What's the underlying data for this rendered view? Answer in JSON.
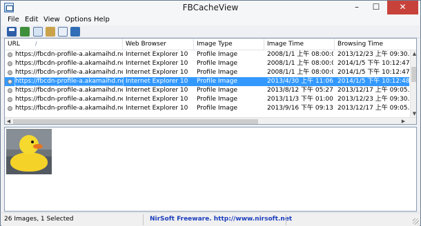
{
  "window": {
    "title": "FBCacheView",
    "controls": {
      "minimize": "–",
      "maximize": "☐",
      "close": "✕"
    }
  },
  "menu": [
    "File",
    "Edit",
    "View",
    "Options",
    "Help"
  ],
  "toolbar": {
    "icons": [
      "save-icon",
      "html-report-icon",
      "copy-icon",
      "properties-icon",
      "find-icon",
      "exit-icon"
    ]
  },
  "table": {
    "columns": [
      "URL",
      "Web Browser",
      "Image Type",
      "Image Time",
      "Browsing Time"
    ],
    "sort_indicator": "/",
    "rows": [
      {
        "url": "https://fbcdn-profile-a.akamaihd.net/...",
        "browser": "Internet Explorer 10",
        "type": "Profile Image",
        "image_time": "2008/1/1 上午 08:00:00",
        "browsing_time": "2013/12/23 上午 09:30..."
      },
      {
        "url": "https://fbcdn-profile-a.akamaihd.net/...",
        "browser": "Internet Explorer 10",
        "type": "Profile Image",
        "image_time": "2008/1/1 上午 08:00:00",
        "browsing_time": "2014/1/5 下午 10:12:47"
      },
      {
        "url": "https://fbcdn-profile-a.akamaihd.net/...",
        "browser": "Internet Explorer 10",
        "type": "Profile Image",
        "image_time": "2008/1/1 上午 08:00:00",
        "browsing_time": "2014/1/5 下午 10:12:47"
      },
      {
        "url": "https://fbcdn-profile-a.akamaihd.net/...",
        "browser": "Internet Explorer 10",
        "type": "Profile Image",
        "image_time": "2013/4/30 上午 11:06:19",
        "browsing_time": "2014/1/5 下午 10:12:48",
        "selected": true
      },
      {
        "url": "https://fbcdn-profile-a.akamaihd.net/...",
        "browser": "Internet Explorer 10",
        "type": "Profile Image",
        "image_time": "2013/8/12 下午 05:27:37",
        "browsing_time": "2013/12/17 上午 09:05..."
      },
      {
        "url": "https://fbcdn-profile-a.akamaihd.net/...",
        "browser": "Internet Explorer 10",
        "type": "Profile Image",
        "image_time": "2013/11/3 下午 01:00:23",
        "browsing_time": "2013/12/23 上午 09:30..."
      },
      {
        "url": "https://fbcdn-profile-a.akamaihd.net/...",
        "browser": "Internet Explorer 10",
        "type": "Profile Image",
        "image_time": "2013/9/16 下午 09:13:40",
        "browsing_time": "2013/12/17 上午 09:05..."
      }
    ]
  },
  "status": {
    "count": "26 Images, 1 Selected",
    "link": "NirSoft Freeware.  http://www.nirsoft.net"
  }
}
